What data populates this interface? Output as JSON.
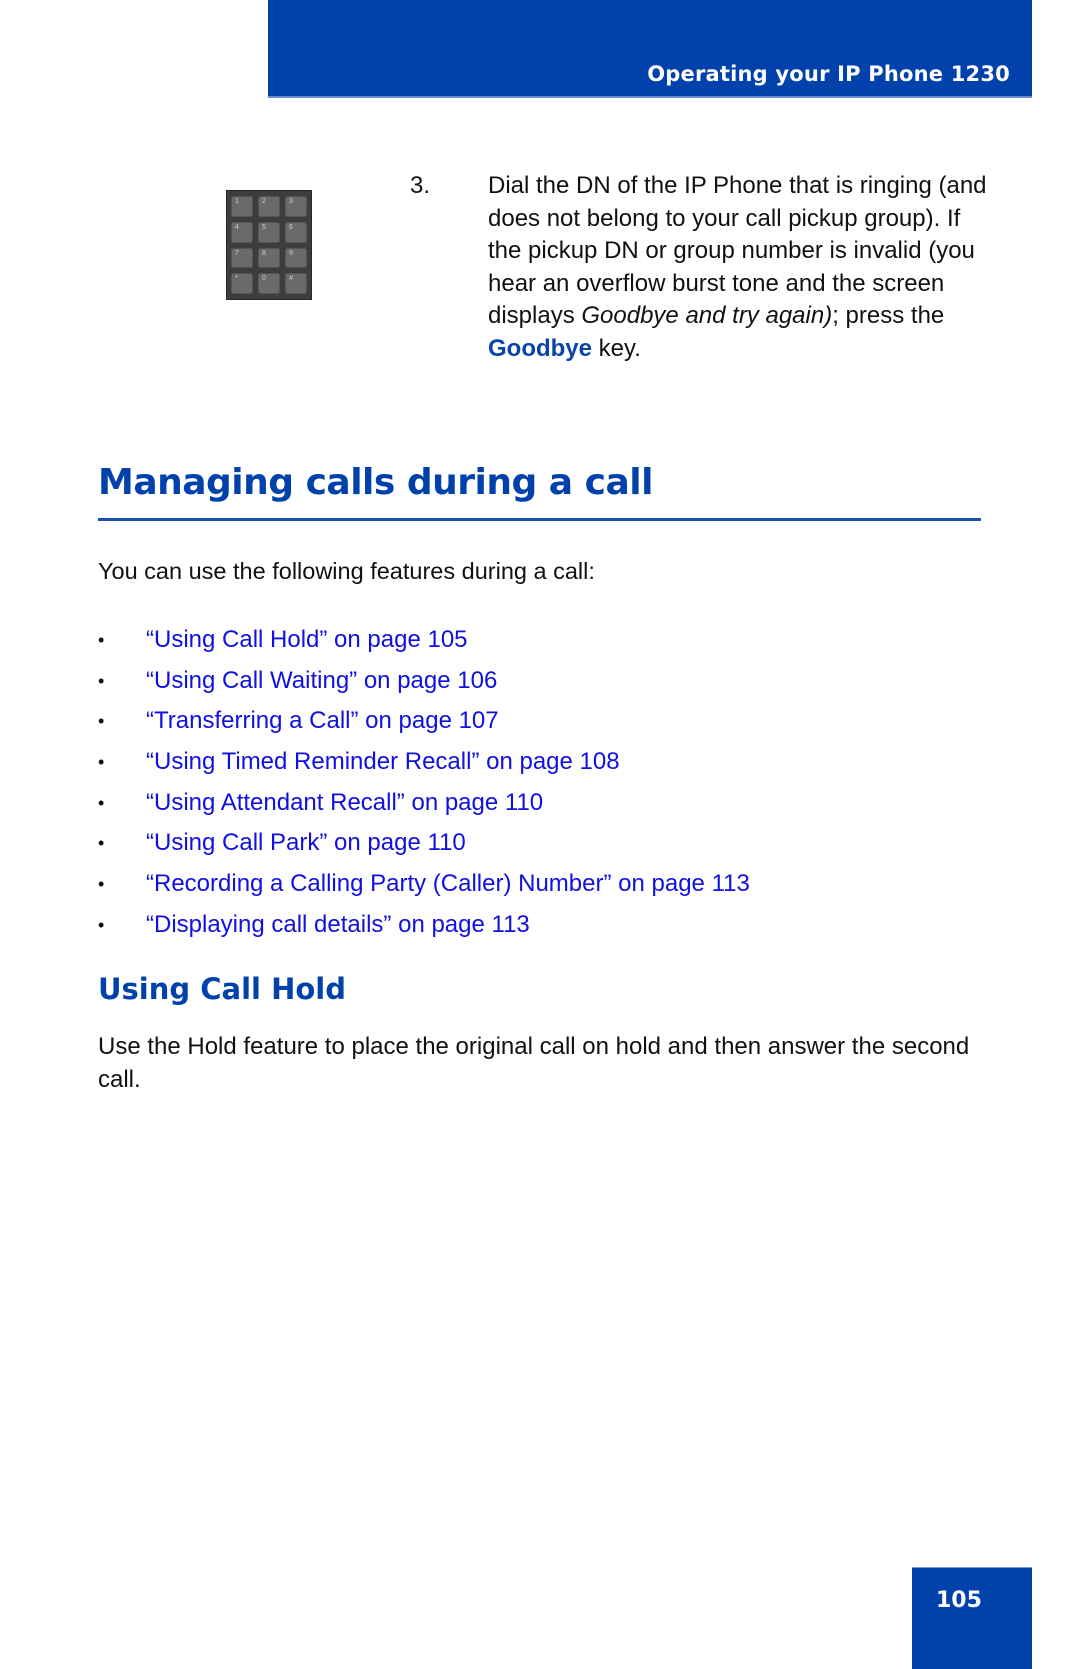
{
  "header": {
    "title": "Operating your IP Phone 1230"
  },
  "keypad_image": {
    "icon": "phone-keypad-icon",
    "keys": [
      "1",
      "2",
      "3",
      "4",
      "5",
      "6",
      "7",
      "8",
      "9",
      "*",
      "0",
      "#"
    ]
  },
  "step": {
    "number": "3.",
    "text_before_italic": "Dial the DN of the IP Phone that is ringing (and does not belong to your call pickup group). If the pickup DN or group number is invalid (you hear an overflow burst tone and the screen displays ",
    "italic_text": "Goodbye and try again)",
    "text_after_italic": "; press the ",
    "key_name": "Goodbye",
    "text_end": " key."
  },
  "section": {
    "heading": "Managing calls during a call",
    "intro": "You can use the following features during a call:",
    "links": [
      {
        "bullet": "•",
        "label": "“Using Call Hold” on page 105"
      },
      {
        "bullet": "•",
        "label": "“Using Call Waiting” on page 106"
      },
      {
        "bullet": "•",
        "label": "“Transferring a Call” on page 107"
      },
      {
        "bullet": "•",
        "label": "“Using Timed Reminder Recall” on page 108"
      },
      {
        "bullet": "•",
        "label": "“Using Attendant Recall” on page 110"
      },
      {
        "bullet": "•",
        "label": "“Using Call Park” on page 110"
      },
      {
        "bullet": "•",
        "label": "“Recording a Calling Party (Caller) Number” on page 113"
      },
      {
        "bullet": "•",
        "label": "“Displaying call details” on page 113"
      }
    ]
  },
  "subsection": {
    "heading": "Using Call Hold",
    "body": "Use the Hold feature to place the original call on hold and then answer the second call."
  },
  "footer": {
    "page_number": "105"
  },
  "colors": {
    "brand_blue": "#0141ab",
    "link_blue": "#1010e0",
    "key_blue": "#0a44a8"
  }
}
